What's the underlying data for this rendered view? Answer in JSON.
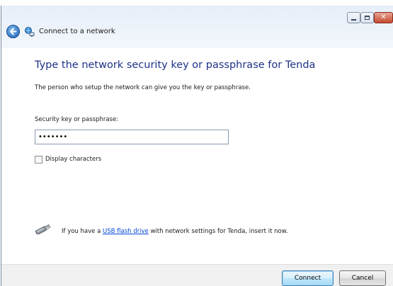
{
  "window": {
    "title": "Connect to a network",
    "controls": {
      "minimize": "minimize",
      "maximize": "maximize",
      "close": "✕"
    }
  },
  "main": {
    "heading": "Type the network security key or passphrase for Tenda",
    "description": "The person who setup the network can give you the key or passphrase.",
    "key_label": "Security key or passphrase:",
    "key_value": "•••••••",
    "display_characters_label": "Display characters",
    "display_characters_checked": false,
    "usb_prefix": "If you have a ",
    "usb_link": "USB flash drive",
    "usb_suffix": " with network settings for Tenda, insert it now."
  },
  "buttons": {
    "connect": "Connect",
    "cancel": "Cancel"
  },
  "colors": {
    "heading": "#1e3287",
    "link": "#0046d5",
    "close_button": "#c44a2f"
  },
  "icons": {
    "back": "back-arrow-icon",
    "network": "network-connection-icon",
    "usb": "usb-drive-icon"
  }
}
